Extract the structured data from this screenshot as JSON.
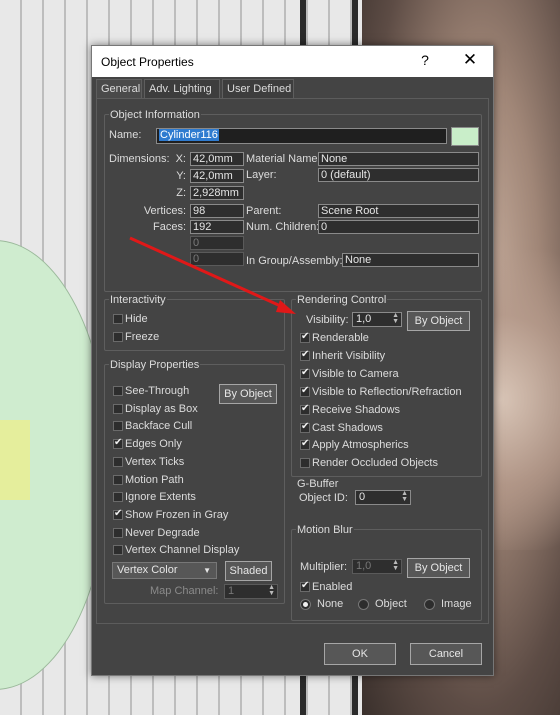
{
  "window": {
    "title": "Object Properties",
    "help": "?",
    "close": "✕"
  },
  "tabs": [
    "General",
    "Adv. Lighting",
    "User Defined"
  ],
  "object_info": {
    "group_title": "Object Information",
    "name_label": "Name:",
    "name_value": "Cylinder116",
    "dimensions_label": "Dimensions:",
    "x_label": "X:",
    "x_value": "42,0mm",
    "y_label": "Y:",
    "y_value": "42,0mm",
    "z_label": "Z:",
    "z_value": "2,928mm",
    "vertices_label": "Vertices:",
    "vertices_value": "98",
    "faces_label": "Faces:",
    "faces_value": "192",
    "blank1_value": "0",
    "blank2_value": "0",
    "material_label": "Material Name:",
    "material_value": "None",
    "layer_label": "Layer:",
    "layer_value": "0 (default)",
    "parent_label": "Parent:",
    "parent_value": "Scene Root",
    "children_label": "Num. Children:",
    "children_value": "0",
    "group_label": "In Group/Assembly:",
    "group_value": "None",
    "color": "#c9eec9"
  },
  "interactivity": {
    "title": "Interactivity",
    "hide": "Hide",
    "hide_checked": false,
    "freeze": "Freeze",
    "freeze_checked": false
  },
  "display": {
    "title": "Display Properties",
    "by_object": "By Object",
    "items": [
      {
        "label": "See-Through",
        "checked": false
      },
      {
        "label": "Display as Box",
        "checked": false
      },
      {
        "label": "Backface Cull",
        "checked": false
      },
      {
        "label": "Edges Only",
        "checked": true
      },
      {
        "label": "Vertex Ticks",
        "checked": false
      },
      {
        "label": "Motion Path",
        "checked": false
      },
      {
        "label": "Ignore Extents",
        "checked": false
      },
      {
        "label": "Show Frozen in Gray",
        "checked": true
      },
      {
        "label": "Never Degrade",
        "checked": false
      },
      {
        "label": "Vertex Channel Display",
        "checked": false
      }
    ],
    "vertex_color": "Vertex Color",
    "shaded": "Shaded",
    "map_channel_label": "Map Channel:",
    "map_channel_value": "1"
  },
  "rendering": {
    "title": "Rendering Control",
    "visibility_label": "Visibility:",
    "visibility_value": "1,0",
    "by_object": "By Object",
    "items": [
      {
        "label": "Renderable",
        "checked": true
      },
      {
        "label": "Inherit Visibility",
        "checked": true
      },
      {
        "label": "Visible to Camera",
        "checked": true
      },
      {
        "label": "Visible to Reflection/Refraction",
        "checked": true
      },
      {
        "label": "Receive Shadows",
        "checked": true
      },
      {
        "label": "Cast Shadows",
        "checked": true
      },
      {
        "label": "Apply Atmospherics",
        "checked": true
      },
      {
        "label": "Render Occluded Objects",
        "checked": false
      }
    ]
  },
  "gbuffer": {
    "title": "G-Buffer",
    "object_id_label": "Object ID:",
    "object_id_value": "0"
  },
  "motion_blur": {
    "title": "Motion Blur",
    "multiplier_label": "Multiplier:",
    "multiplier_value": "1,0",
    "by_object": "By Object",
    "enabled": "Enabled",
    "enabled_checked": true,
    "options": [
      "None",
      "Object",
      "Image"
    ],
    "selected": "None"
  },
  "footer": {
    "ok": "OK",
    "cancel": "Cancel"
  }
}
